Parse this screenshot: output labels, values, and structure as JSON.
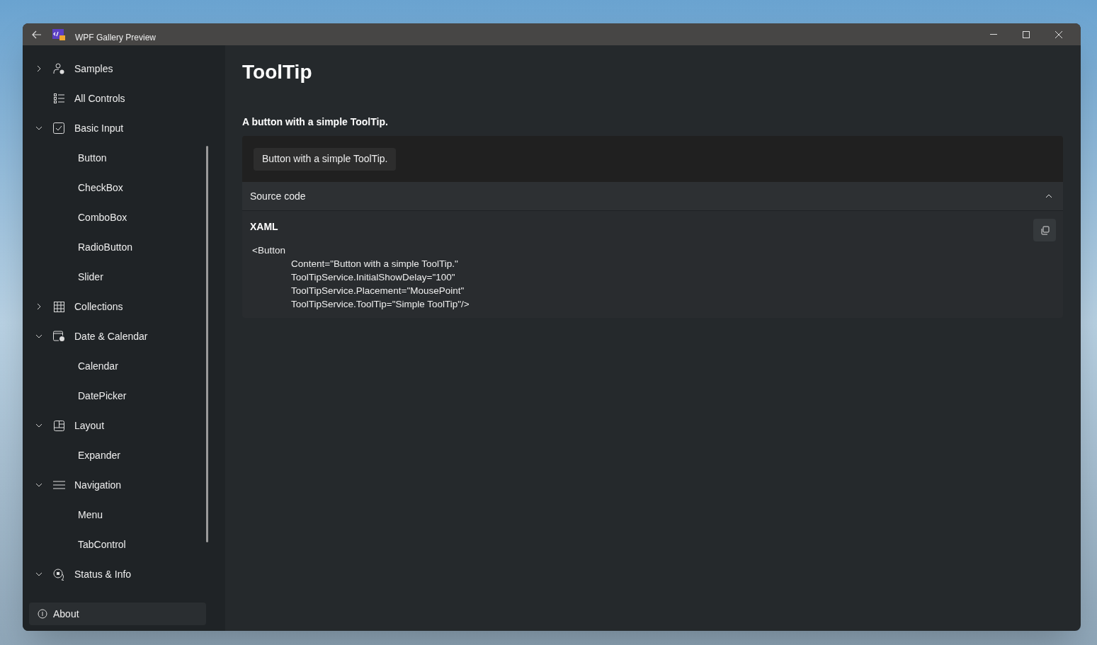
{
  "window": {
    "title": "WPF Gallery Preview"
  },
  "sidebar": {
    "items": [
      {
        "label": "Samples",
        "kind": "group",
        "expanded": false
      },
      {
        "label": "All Controls",
        "kind": "page"
      },
      {
        "label": "Basic Input",
        "kind": "group",
        "expanded": true,
        "children": [
          {
            "label": "Button"
          },
          {
            "label": "CheckBox"
          },
          {
            "label": "ComboBox"
          },
          {
            "label": "RadioButton"
          },
          {
            "label": "Slider"
          }
        ]
      },
      {
        "label": "Collections",
        "kind": "group",
        "expanded": false
      },
      {
        "label": "Date & Calendar",
        "kind": "group",
        "expanded": true,
        "children": [
          {
            "label": "Calendar"
          },
          {
            "label": "DatePicker"
          }
        ]
      },
      {
        "label": "Layout",
        "kind": "group",
        "expanded": true,
        "children": [
          {
            "label": "Expander"
          }
        ]
      },
      {
        "label": "Navigation",
        "kind": "group",
        "expanded": true,
        "children": [
          {
            "label": "Menu"
          },
          {
            "label": "TabControl"
          }
        ]
      },
      {
        "label": "Status & Info",
        "kind": "group",
        "expanded": true
      }
    ],
    "footer": {
      "label": "About"
    }
  },
  "page": {
    "title": "ToolTip",
    "example": {
      "heading": "A button with a simple ToolTip.",
      "button": "Button with a simple ToolTip.",
      "source": {
        "header": "Source code",
        "expanded": true,
        "language": "XAML",
        "code": {
          "element": "<Button",
          "attributes": [
            "Content=\"Button with a simple ToolTip.\"",
            "ToolTipService.InitialShowDelay=\"100\"",
            "ToolTipService.Placement=\"MousePoint\"",
            "ToolTipService.ToolTip=\"Simple ToolTip\"/>"
          ]
        }
      }
    }
  }
}
